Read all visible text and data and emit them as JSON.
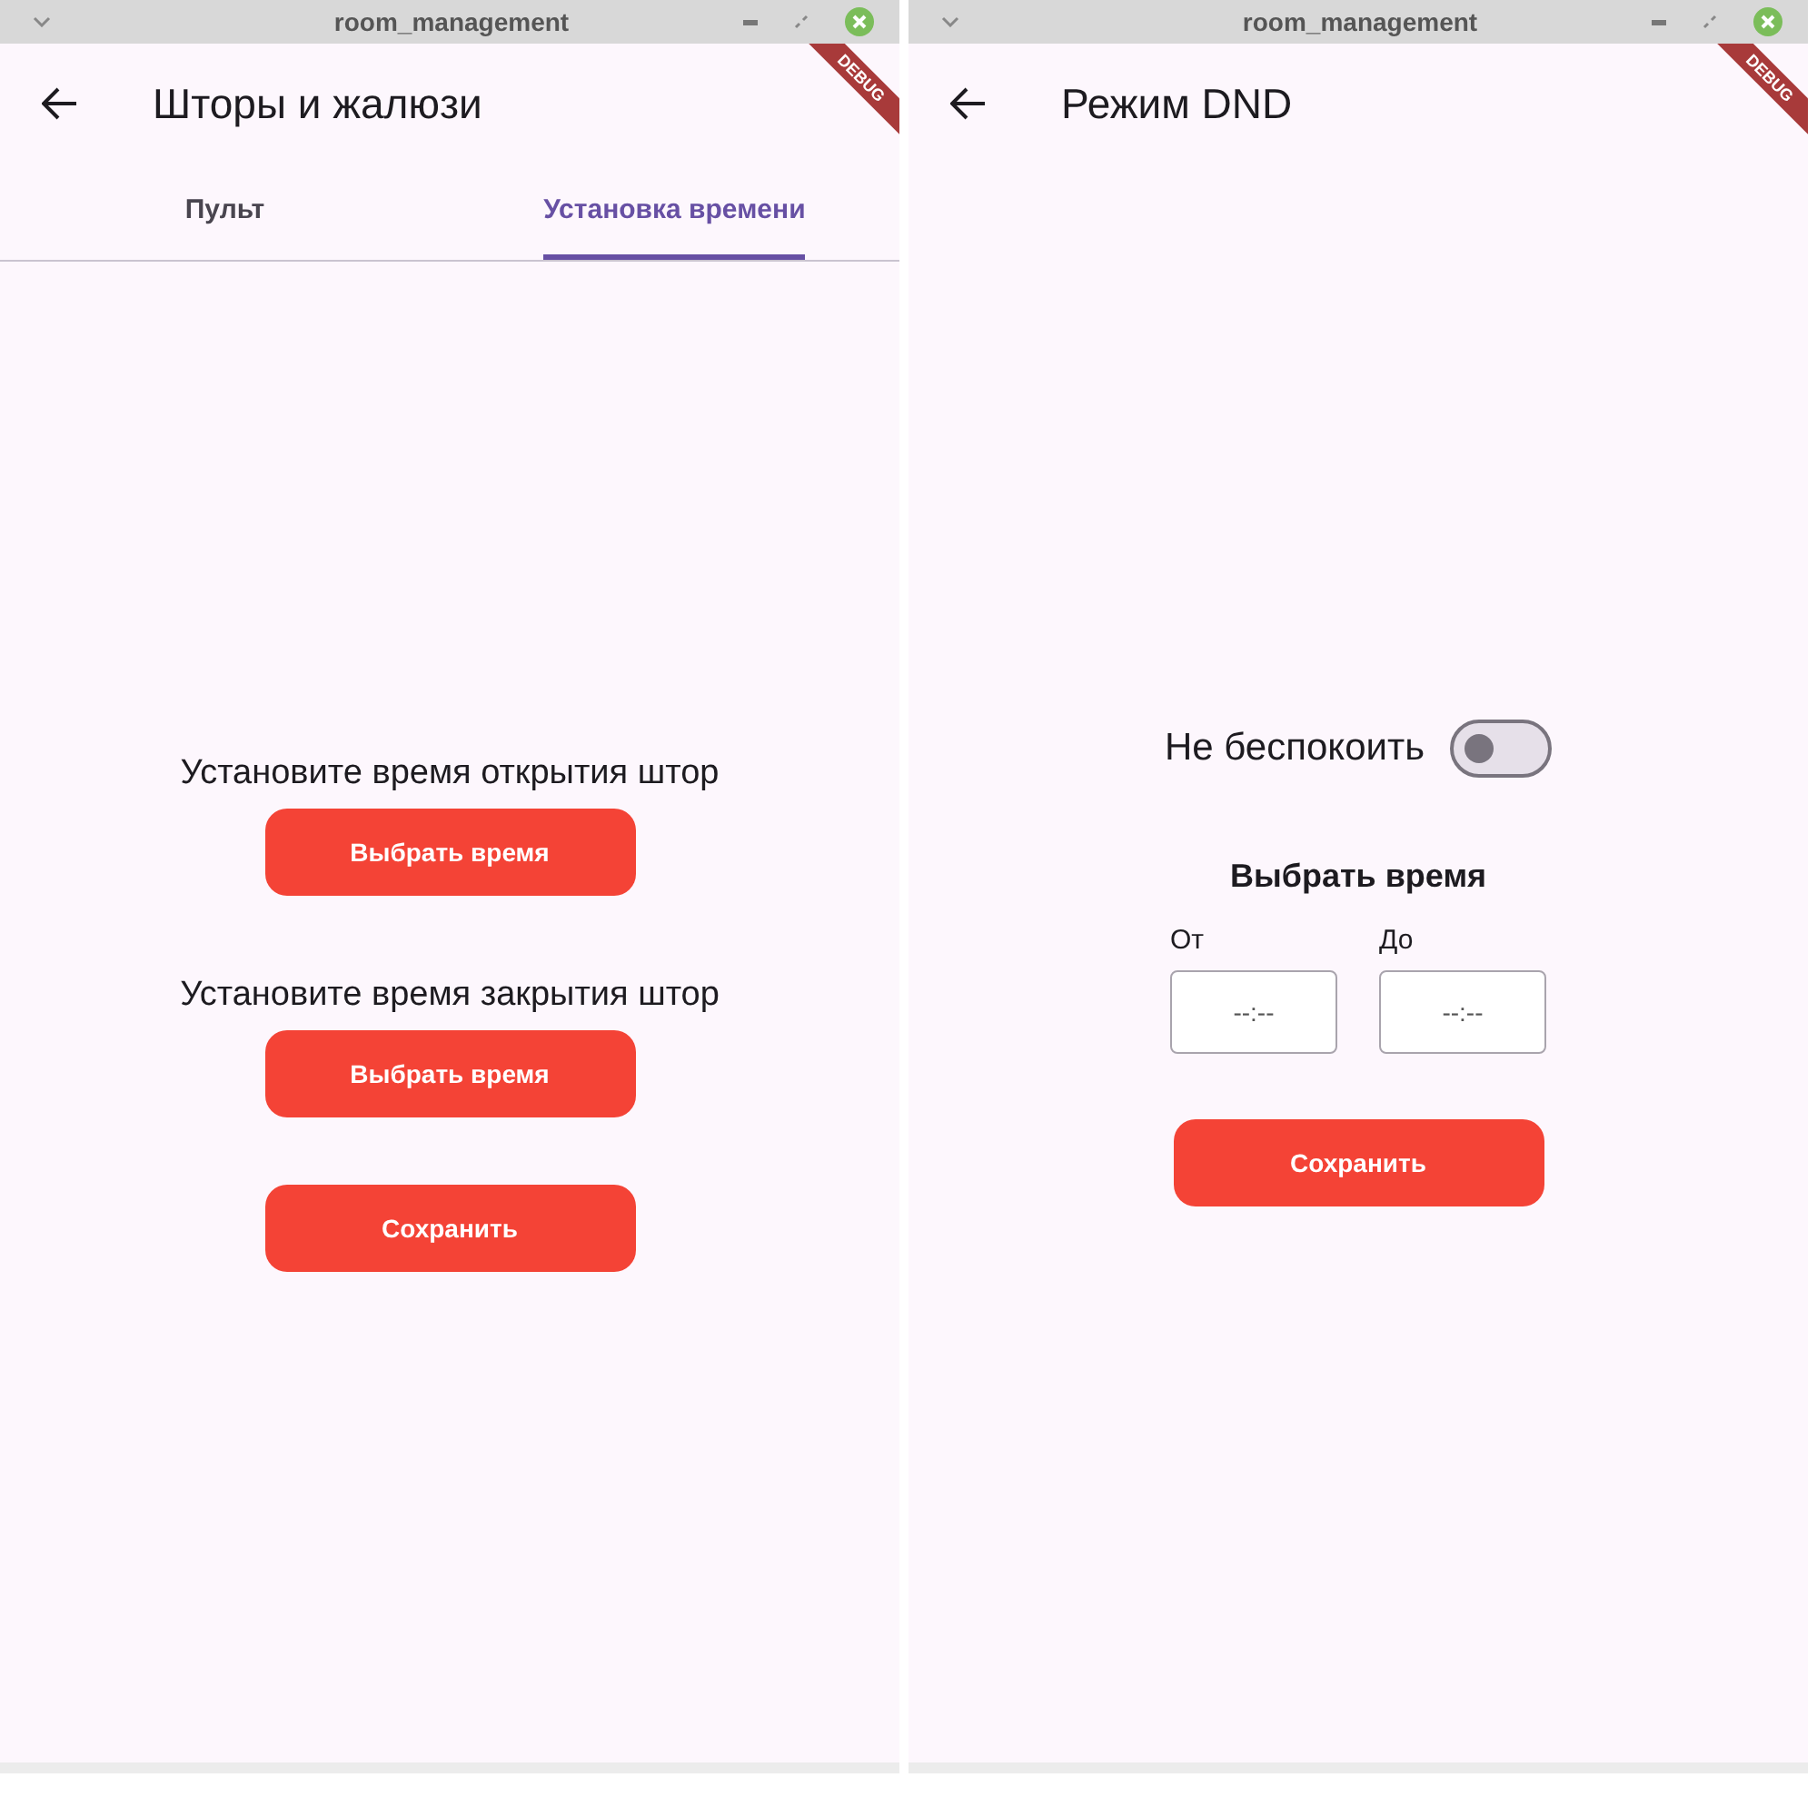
{
  "windows": [
    {
      "title_bar": {
        "title": "room_management"
      },
      "app_bar": {
        "title": "Шторы и жалюзи"
      },
      "debug_banner": "DEBUG",
      "tabs": [
        {
          "label": "Пульт",
          "selected": false
        },
        {
          "label": "Установка времени",
          "selected": true
        }
      ],
      "content": {
        "kind": "schedule",
        "sections": [
          {
            "label": "Установите время открытия штор",
            "button": "Выбрать время"
          },
          {
            "label": "Установите время закрытия штор",
            "button": "Выбрать время"
          }
        ],
        "save_button": "Сохранить"
      }
    },
    {
      "title_bar": {
        "title": "room_management"
      },
      "app_bar": {
        "title": "Режим DND"
      },
      "debug_banner": "DEBUG",
      "content": {
        "kind": "dnd",
        "toggle": {
          "label": "Не беспокоить",
          "on": false
        },
        "heading": "Выбрать время",
        "fields": [
          {
            "label": "От",
            "placeholder": "--:--"
          },
          {
            "label": "До",
            "placeholder": "--:--"
          }
        ],
        "save_button": "Сохранить"
      }
    }
  ]
}
